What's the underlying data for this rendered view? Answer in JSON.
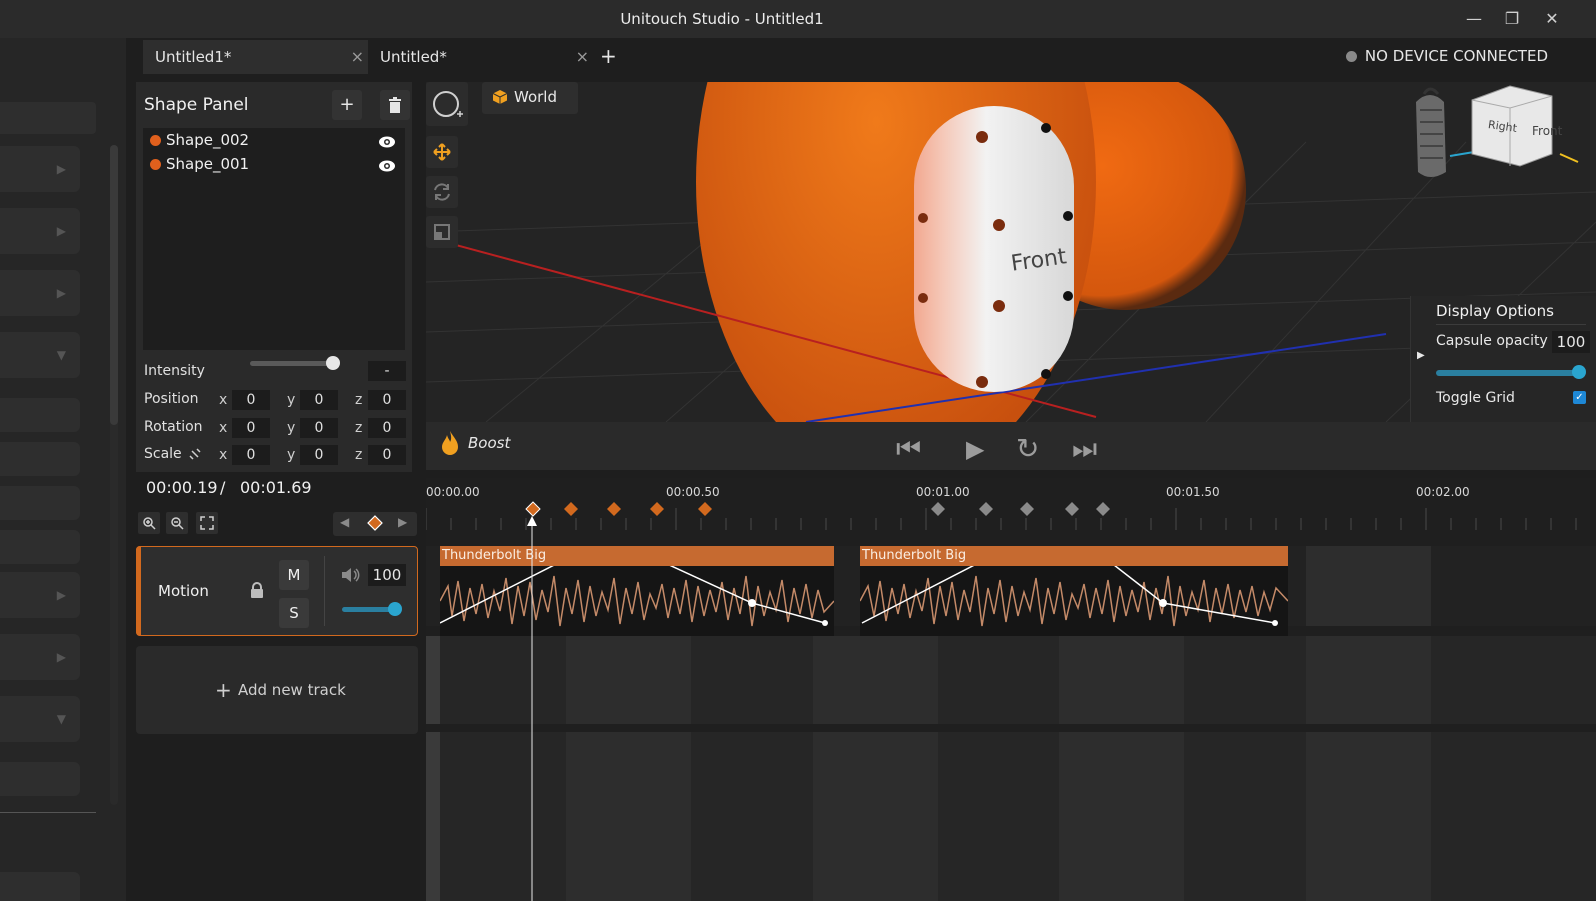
{
  "window": {
    "title": "Unitouch Studio - Untitled1",
    "minimize": "—",
    "restore": "❐",
    "close": "✕"
  },
  "tabs": [
    {
      "label": "Untitled1*",
      "close": "×"
    },
    {
      "label": "Untitled*",
      "close": "×"
    }
  ],
  "new_tab": "+",
  "device_status": "NO DEVICE CONNECTED",
  "shape_panel": {
    "title": "Shape Panel",
    "add": "+",
    "shapes": [
      {
        "name": "Shape_002",
        "color": "#e0601d"
      },
      {
        "name": "Shape_001",
        "color": "#e0601d"
      }
    ],
    "intensity_label": "Intensity",
    "intensity_value": "-",
    "intensity_fraction": 0.95,
    "position": {
      "label": "Position",
      "x": "0",
      "y": "0",
      "z": "0"
    },
    "rotation": {
      "label": "Rotation",
      "x": "0",
      "y": "0",
      "z": "0"
    },
    "scale": {
      "label": "Scale",
      "x": "0",
      "y": "0",
      "z": "0"
    },
    "axis_x": "x",
    "axis_y": "y",
    "axis_z": "z"
  },
  "viewport": {
    "space_button": "World",
    "capsule_label": "Front",
    "gizmo_right": "Right",
    "gizmo_front": "Front"
  },
  "display_options": {
    "title": "Display Options",
    "capsule_opacity_label": "Capsule opacity",
    "capsule_opacity": "100",
    "toggle_grid_label": "Toggle Grid",
    "toggle_grid": true
  },
  "transport": {
    "effect_name": "Boost",
    "skip_back": "⏮",
    "play": "▶",
    "loop": "↻",
    "skip_forward": "⏭"
  },
  "time": {
    "current": "00:00.19",
    "separator": "/",
    "total": "00:01.69"
  },
  "ruler": [
    "00:00.00",
    "00:00.50",
    "00:01.00",
    "00:01.50",
    "00:02.00"
  ],
  "track": {
    "name": "Motion",
    "mute": "M",
    "solo": "S",
    "volume": "100",
    "volume_fraction": 1.0,
    "clips": [
      "Thunderbolt Big",
      "Thunderbolt Big"
    ]
  },
  "add_track": "Add new track",
  "colors": {
    "accent": "#d2691e",
    "clip": "#c66a30",
    "shape": "#e0601d",
    "slider": "#2aa5cf"
  }
}
